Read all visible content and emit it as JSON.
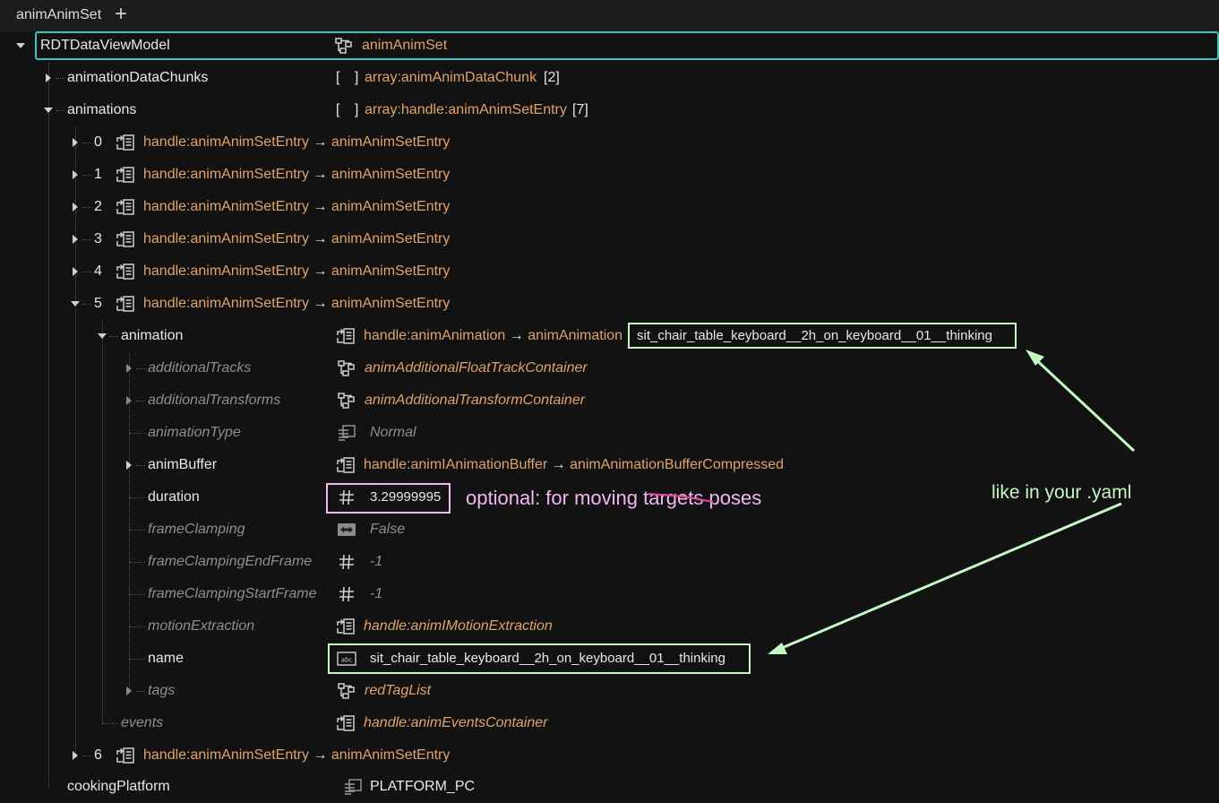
{
  "tab": {
    "title": "animAnimSet",
    "add_label": "+"
  },
  "root": {
    "label": "RDTDataViewModel",
    "value": "animAnimSet"
  },
  "rows": {
    "chunks": {
      "label": "animationDataChunks",
      "bracket": "[ ]",
      "type": "array:animAnimDataChunk",
      "count": "[2]"
    },
    "animations": {
      "label": "animations",
      "bracket": "[ ]",
      "type": "array:handle:animAnimSetEntry",
      "count": "[7]"
    },
    "entries": [
      {
        "index": "0",
        "handle": "handle:animAnimSetEntry",
        "arrow": "→",
        "target": "animAnimSetEntry"
      },
      {
        "index": "1",
        "handle": "handle:animAnimSetEntry",
        "arrow": "→",
        "target": "animAnimSetEntry"
      },
      {
        "index": "2",
        "handle": "handle:animAnimSetEntry",
        "arrow": "→",
        "target": "animAnimSetEntry"
      },
      {
        "index": "3",
        "handle": "handle:animAnimSetEntry",
        "arrow": "→",
        "target": "animAnimSetEntry"
      },
      {
        "index": "4",
        "handle": "handle:animAnimSetEntry",
        "arrow": "→",
        "target": "animAnimSetEntry"
      },
      {
        "index": "5",
        "handle": "handle:animAnimSetEntry",
        "arrow": "→",
        "target": "animAnimSetEntry"
      },
      {
        "index": "6",
        "handle": "handle:animAnimSetEntry",
        "arrow": "→",
        "target": "animAnimSetEntry"
      }
    ],
    "animation": {
      "label": "animation",
      "handle": "handle:animAnimation",
      "arrow": "→",
      "target": "animAnimation",
      "name": "sit_chair_table_keyboard__2h_on_keyboard__01__thinking"
    },
    "additionalTracks": {
      "label": "additionalTracks",
      "value": "animAdditionalFloatTrackContainer"
    },
    "additionalTransforms": {
      "label": "additionalTransforms",
      "value": "animAdditionalTransformContainer"
    },
    "animationType": {
      "label": "animationType",
      "value": "Normal"
    },
    "animBuffer": {
      "label": "animBuffer",
      "handle": "handle:animIAnimationBuffer",
      "arrow": "→",
      "target": "animAnimationBufferCompressed"
    },
    "duration": {
      "label": "duration",
      "value": "3.29999995"
    },
    "frameClamping": {
      "label": "frameClamping",
      "value": "False"
    },
    "frameClampingEndFrame": {
      "label": "frameClampingEndFrame",
      "value": "-1"
    },
    "frameClampingStartFrame": {
      "label": "frameClampingStartFrame",
      "value": "-1"
    },
    "motionExtraction": {
      "label": "motionExtraction",
      "value": "handle:animIMotionExtraction"
    },
    "name": {
      "label": "name",
      "value": "sit_chair_table_keyboard__2h_on_keyboard__01__thinking"
    },
    "tags": {
      "label": "tags",
      "value": "redTagList"
    },
    "events": {
      "label": "events",
      "value": "handle:animEventsContainer"
    },
    "cookingPlatform": {
      "label": "cookingPlatform",
      "value": "PLATFORM_PC"
    }
  },
  "annotations": {
    "optional_prefix": "optional: for moving ",
    "optional_struck": "targets",
    "optional_suffix": " poses",
    "yaml_note": "like in your .yaml"
  },
  "colors": {
    "value": "#e0a36a",
    "selection": "#3bc4bd",
    "green_annotation": "#c6f5c6",
    "pink_annotation": "#f2b6f2"
  }
}
